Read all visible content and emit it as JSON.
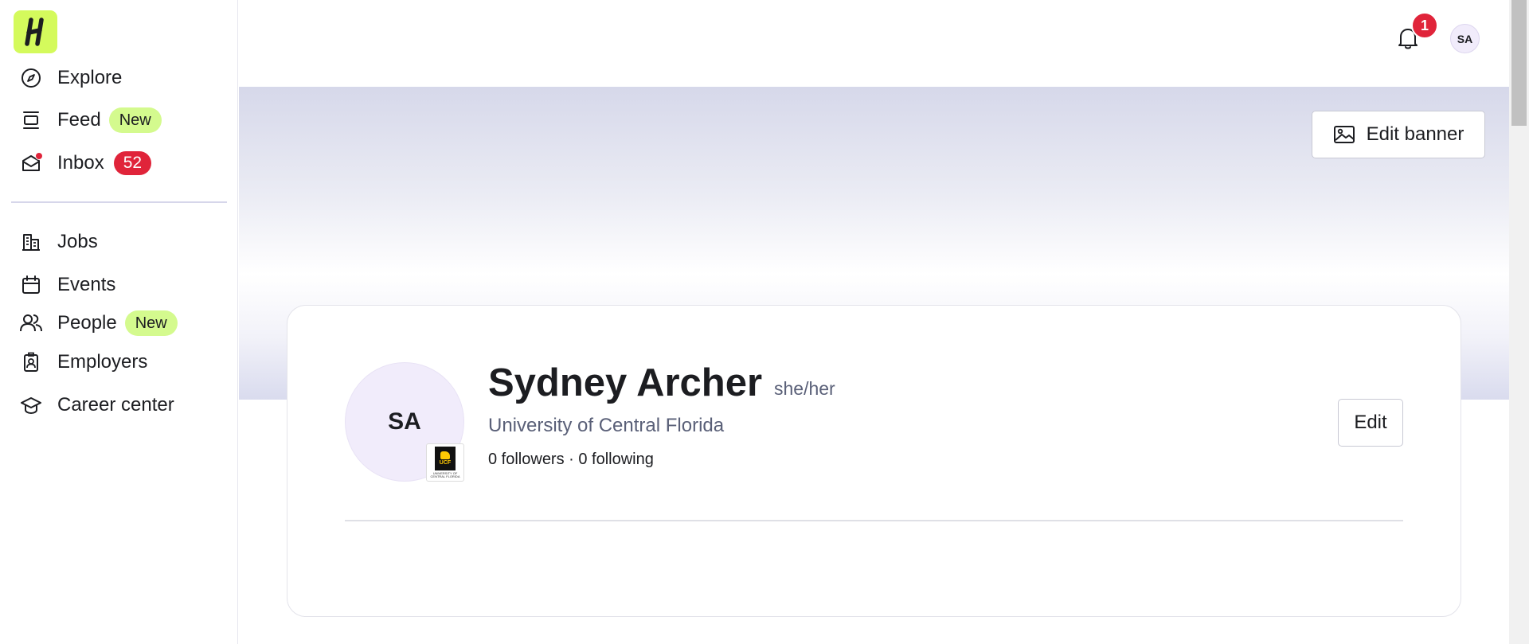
{
  "sidebar": {
    "logo_text": "H",
    "items": [
      {
        "label": "Explore",
        "icon": "compass-icon"
      },
      {
        "label": "Feed",
        "icon": "feed-icon",
        "badge": "New"
      },
      {
        "label": "Inbox",
        "icon": "inbox-icon",
        "count": "52"
      },
      {
        "label": "Jobs",
        "icon": "building-icon"
      },
      {
        "label": "Events",
        "icon": "calendar-icon"
      },
      {
        "label": "People",
        "icon": "people-icon",
        "badge": "New"
      },
      {
        "label": "Employers",
        "icon": "id-badge-icon"
      },
      {
        "label": "Career center",
        "icon": "graduation-cap-icon"
      }
    ]
  },
  "header": {
    "notification_count": "1",
    "user_initials": "SA"
  },
  "banner": {
    "edit_label": "Edit banner"
  },
  "profile": {
    "initials": "SA",
    "name": "Sydney Archer",
    "pronouns": "she/her",
    "school": "University of Central Florida",
    "school_logo_text": "UCF",
    "school_logo_subtext": "UNIVERSITY OF CENTRAL FLORIDA",
    "followers_text": "0 followers · 0 following",
    "edit_label": "Edit"
  },
  "colors": {
    "brand_lime": "#d4fa5c",
    "badge_new": "#d4fa8e",
    "alert_red": "#e0243a",
    "avatar_lavender": "#f1ecfb"
  }
}
